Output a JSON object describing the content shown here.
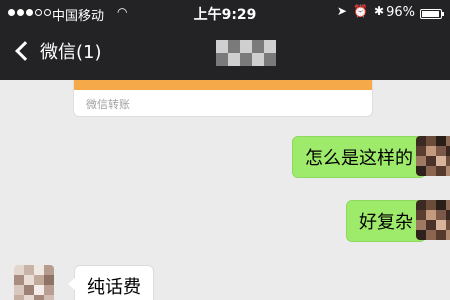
{
  "status_bar": {
    "carrier": "中国移动",
    "time": "上午9:29",
    "battery": "96%",
    "battery_level": 0.96,
    "signal_bars_filled": 3,
    "signal_bars_total": 5,
    "icons": [
      "location-arrow-icon",
      "alarm-clock-icon",
      "bluetooth-icon"
    ]
  },
  "nav": {
    "back_label": "微信(1)",
    "title_pixelated": true
  },
  "transfer_card": {
    "label": "微信转账",
    "accent_color": "#f6a948"
  },
  "messages": [
    {
      "side": "right",
      "text": "怎么是这样的"
    },
    {
      "side": "right",
      "text": "好复杂"
    },
    {
      "side": "left",
      "text": "纯话费"
    }
  ],
  "colors": {
    "header_bg": "#232326",
    "chat_bg": "#ebebeb",
    "my_bubble": "#9eea6a",
    "their_bubble": "#ffffff"
  }
}
